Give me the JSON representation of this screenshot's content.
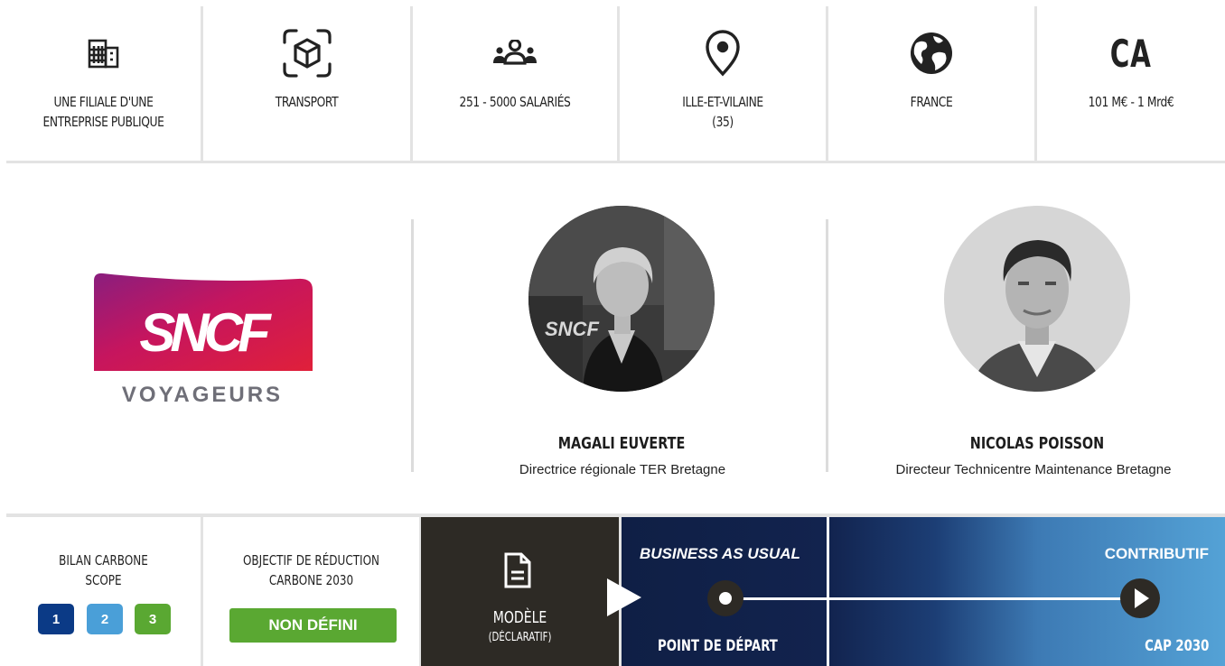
{
  "info": {
    "ownership": "Une filiale d'une entreprise publique",
    "sector": "Transport",
    "employees": "251 - 5000 salariés",
    "department": "Ille-et-Vilaine (35)",
    "country": "France",
    "revenue_mark": "CA",
    "revenue": "101 M€ - 1 Mrd€",
    "icons": [
      "building-icon",
      "cube-scan-icon",
      "people-group-icon",
      "location-pin-icon",
      "globe-icon"
    ]
  },
  "company": {
    "logo_brand": "SNCF",
    "logo_sub": "VOYAGEURS"
  },
  "people": [
    {
      "name": "Magali Euverte",
      "role": "Directrice régionale TER Bretagne"
    },
    {
      "name": "Nicolas Poisson",
      "role": "Directeur Technicentre Maintenance Bretagne"
    }
  ],
  "bilan": {
    "title": "Bilan carbone scope",
    "scopes": [
      "1",
      "2",
      "3"
    ],
    "scope_colors": [
      "#0b3a86",
      "#4a9fd8",
      "#5aa832"
    ]
  },
  "objectif": {
    "title": "Objectif de réduction carbone 2030",
    "value": "NON DÉFINI"
  },
  "model": {
    "title": "Modèle",
    "subtitle": "(déclaratif)"
  },
  "timeline": {
    "start_heading": "Business as usual",
    "end_heading": "Contributif",
    "start_label": "Point de départ",
    "end_label": "Cap 2030"
  },
  "colors": {
    "dark": "#2d2a25",
    "navy": "#0f1f45",
    "sky": "#54a2d6",
    "green": "#5aa832"
  }
}
